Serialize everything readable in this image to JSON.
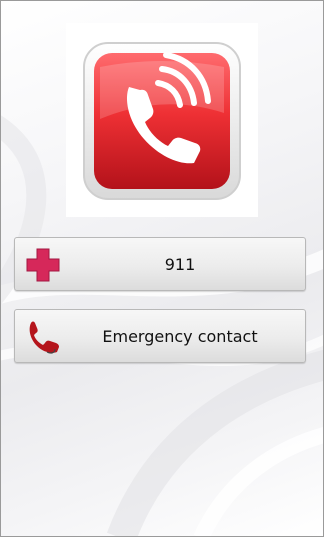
{
  "buttons": {
    "call_911": {
      "label": "911",
      "icon": "red-cross-icon"
    },
    "emergency_contact": {
      "label": "Emergency contact",
      "icon": "phone-handset-icon"
    }
  },
  "logo": {
    "icon": "ringing-phone-icon",
    "color": "#e5282b"
  },
  "colors": {
    "accent_red": "#e5282b",
    "cross_red": "#d6285a",
    "button_bg": "#e9e9e9"
  }
}
